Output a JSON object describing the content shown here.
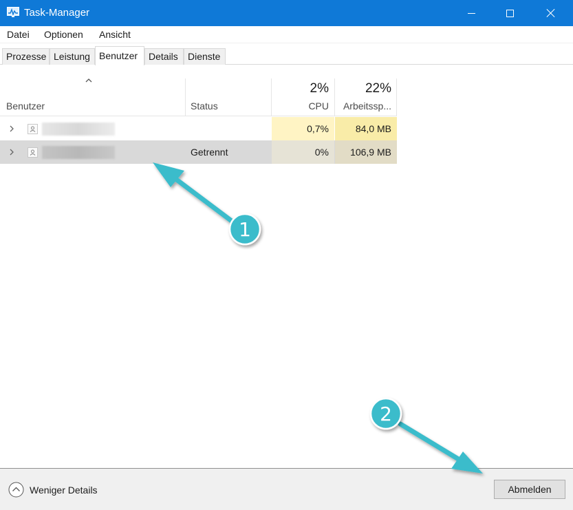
{
  "window": {
    "title": "Task-Manager",
    "controls": {
      "minimize": "minimize",
      "maximize": "maximize",
      "close": "close"
    }
  },
  "menu": [
    "Datei",
    "Optionen",
    "Ansicht"
  ],
  "tabs": [
    {
      "label": "Prozesse",
      "active": false
    },
    {
      "label": "Leistung",
      "active": false
    },
    {
      "label": "Benutzer",
      "active": true
    },
    {
      "label": "Details",
      "active": false
    },
    {
      "label": "Dienste",
      "active": false
    }
  ],
  "table": {
    "columns": {
      "user": "Benutzer",
      "status": "Status",
      "cpu": {
        "percent": "2%",
        "label": "CPU"
      },
      "memory": {
        "percent": "22%",
        "label": "Arbeitssp..."
      }
    },
    "rows": [
      {
        "status": "",
        "cpu": "0,7%",
        "memory": "84,0 MB",
        "selected": false
      },
      {
        "status": "Getrennt",
        "cpu": "0%",
        "memory": "106,9 MB",
        "selected": true
      }
    ]
  },
  "footer": {
    "less_details": "Weniger Details",
    "logout_button": "Abmelden"
  },
  "annotations": [
    {
      "number": "1"
    },
    {
      "number": "2"
    }
  ],
  "colors": {
    "titlebar": "#0f79d7",
    "heat_light": "#fff4c4",
    "heat_medium": "#f9eca8",
    "selected_row": "#d9d9d9",
    "annotation": "#3bbccb"
  }
}
